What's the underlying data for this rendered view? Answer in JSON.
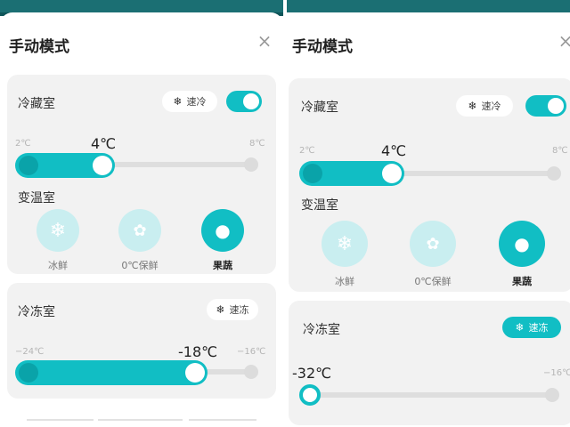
{
  "colors": {
    "accent": "#11bec4",
    "accent_light": "#c9eef0",
    "header_bar": "#1b6f73"
  },
  "left": {
    "title": "手动模式",
    "close_icon": "×",
    "fridge": {
      "label": "冷藏室",
      "quick_chip": {
        "icon": "snowflake-icon",
        "label": "速冷"
      },
      "toggle_on": true,
      "min": "2℃",
      "max": "8℃",
      "value": "4℃"
    },
    "variable": {
      "label": "变温室",
      "modes": [
        {
          "icon": "snowflake-icon",
          "label": "冰鲜",
          "selected": false
        },
        {
          "icon": "lotus-icon",
          "label": "0℃保鲜",
          "selected": false
        },
        {
          "icon": "apple-icon",
          "label": "果蔬",
          "selected": true
        }
      ]
    },
    "freezer": {
      "label": "冷冻室",
      "quick_chip": {
        "icon": "snowflake-icon",
        "label": "速冻",
        "active": false
      },
      "min": "−24℃",
      "max": "−16℃",
      "value": "-18℃"
    }
  },
  "right": {
    "title": "手动模式",
    "close_icon": "×",
    "fridge": {
      "label": "冷藏室",
      "quick_chip": {
        "icon": "snowflake-icon",
        "label": "速冷"
      },
      "toggle_on": true,
      "min": "2℃",
      "max": "8℃",
      "value": "4℃"
    },
    "variable": {
      "label": "变温室",
      "modes": [
        {
          "icon": "snowflake-icon",
          "label": "冰鲜",
          "selected": false
        },
        {
          "icon": "lotus-icon",
          "label": "0℃保鲜",
          "selected": false
        },
        {
          "icon": "apple-icon",
          "label": "果蔬",
          "selected": true
        }
      ]
    },
    "freezer": {
      "label": "冷冻室",
      "quick_chip": {
        "icon": "snowflake-icon",
        "label": "速冻",
        "active": true
      },
      "max": "−16℃",
      "value": "-32℃"
    }
  }
}
